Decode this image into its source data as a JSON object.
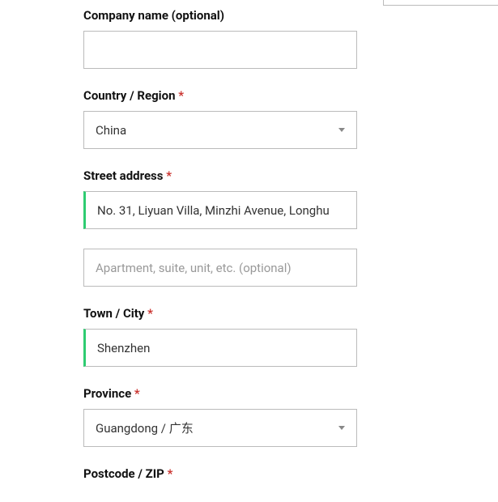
{
  "form": {
    "company": {
      "label": "Company name (optional)",
      "value": ""
    },
    "country": {
      "label": "Country / Region",
      "required": true,
      "value": "China"
    },
    "street": {
      "label": "Street address",
      "required": true,
      "line1_value": "No. 31, Liyuan Villa, Minzhi Avenue, Longhu",
      "line2_placeholder": "Apartment, suite, unit, etc. (optional)",
      "line2_value": ""
    },
    "city": {
      "label": "Town / City",
      "required": true,
      "value": "Shenzhen"
    },
    "province": {
      "label": "Province",
      "required": true,
      "value": "Guangdong / 广东"
    },
    "postcode": {
      "label": "Postcode / ZIP",
      "required": true
    }
  },
  "symbols": {
    "required": "*"
  }
}
